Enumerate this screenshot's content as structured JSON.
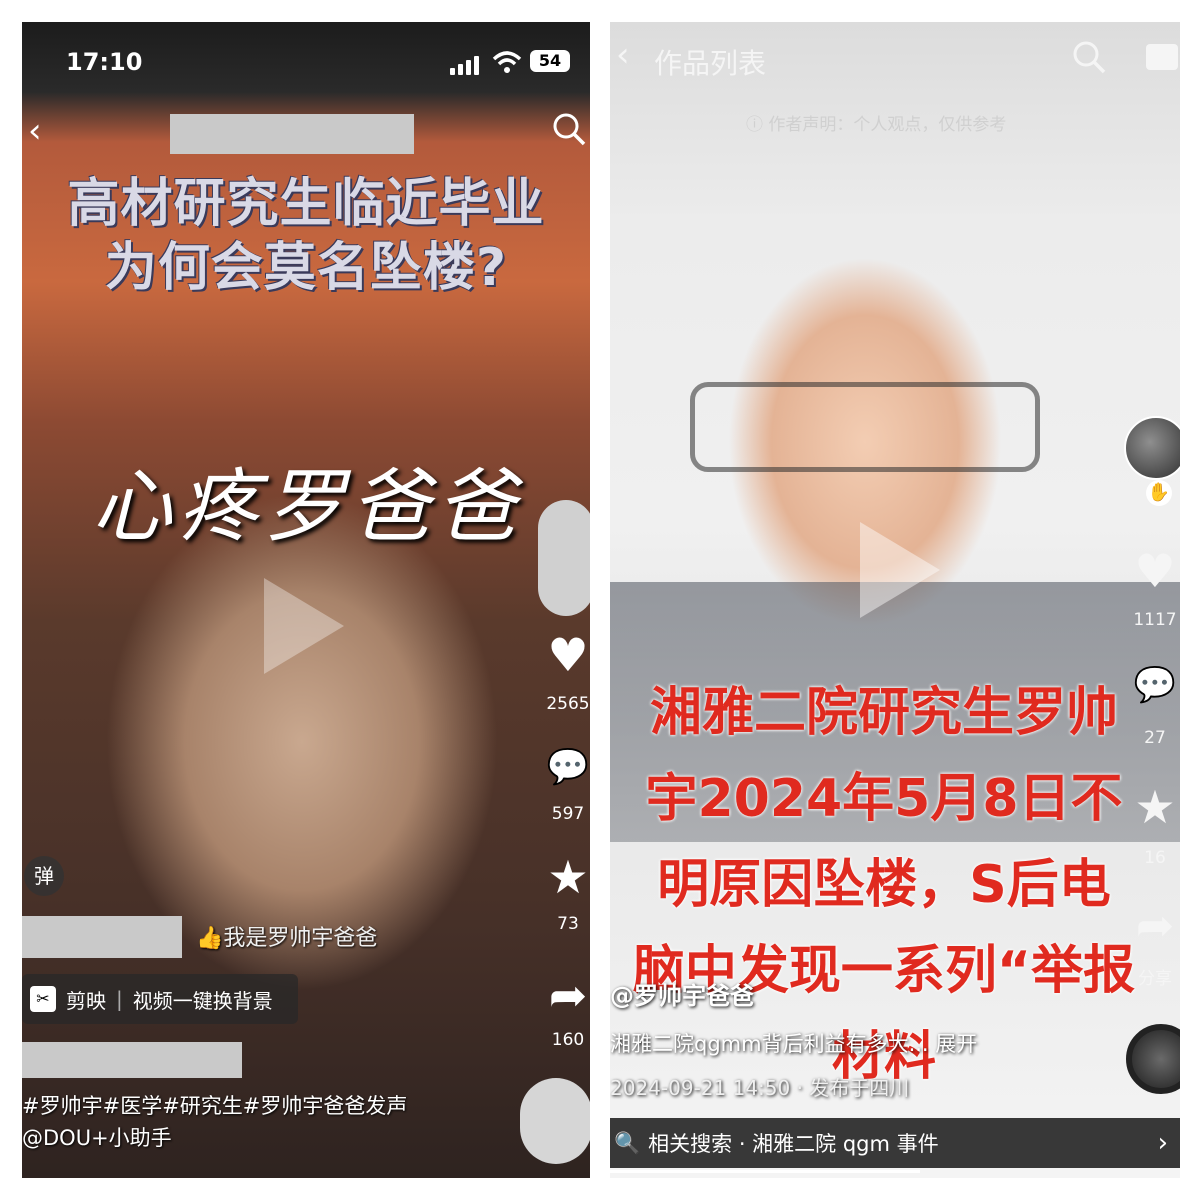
{
  "left_panel": {
    "status": {
      "time": "17:10",
      "battery": "54"
    },
    "headline_line1": "高材研究生临近毕业",
    "headline_line2": "为何会莫名坠楼?",
    "sticker_text": "心疼罗爸爸",
    "danmaku_label": "弹",
    "rail": {
      "likes": "2565",
      "comments": "597",
      "favorites": "73",
      "shares": "160"
    },
    "author_tag": "我是罗帅宇爸爸",
    "capcut": {
      "brand": "剪映",
      "slogan": "视频一键换背景"
    },
    "caption": "#罗帅宇#医学#研究生#罗帅宇爸爸发声",
    "mention": "@DOU+小助手"
  },
  "right_panel": {
    "header_title": "作品列表",
    "disclaimer": "作者声明：个人观点，仅供参考",
    "overlay_lines": [
      "湘雅二院研究生罗帅",
      "宇2024年5月8日不",
      "明原因坠楼，S后电",
      "脑中发现一系列“举报",
      "材料"
    ],
    "rail": {
      "likes": "1117",
      "comments": "27",
      "favorites": "16",
      "share_label": "分享"
    },
    "author": "@罗帅宇爸爸",
    "description": "湘雅二院qgmm背后利益有多大... 展开",
    "post_meta": "2024-09-21 14:50 · 发布于四川",
    "related_search": "相关搜索 · 湘雅二院 qgm 事件",
    "colors": {
      "overlay_red": "#e02a1f"
    }
  }
}
